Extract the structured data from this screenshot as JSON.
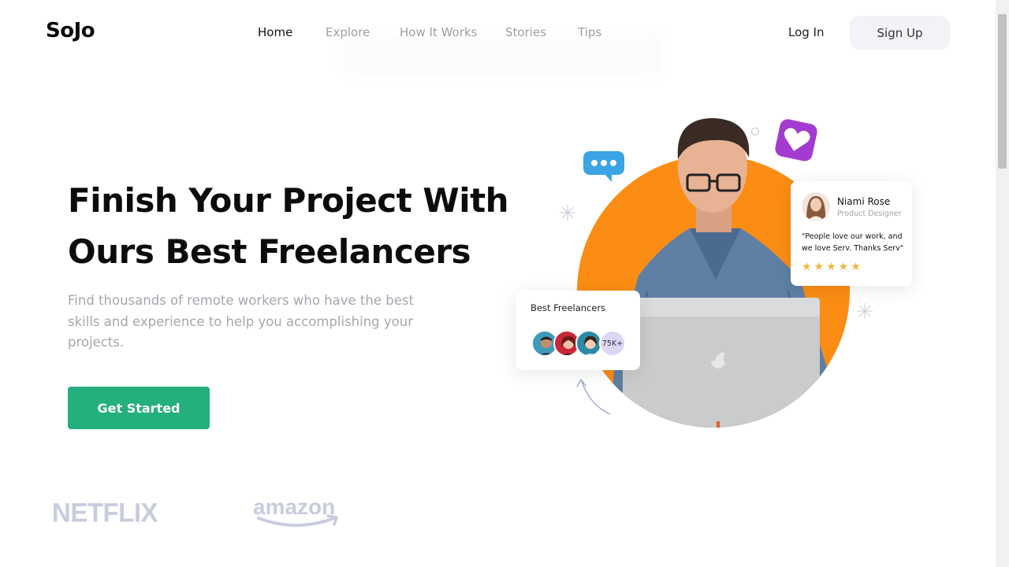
{
  "header": {
    "logo": "SoJo",
    "nav": [
      "Home",
      "Explore",
      "How It Works",
      "Stories",
      "Tips"
    ],
    "login_label": "Log In",
    "signup_label": "Sign Up"
  },
  "hero": {
    "title_line1": "Finish Your Project With",
    "title_line2": "Ours Best Freelancers",
    "subtitle": "Find thousands of remote workers who have the best skills and experience to help you accomplishing your projects.",
    "cta_label": "Get Started"
  },
  "freelancers_card": {
    "title": "Best Freelancers",
    "count": "75K+"
  },
  "review_card": {
    "name": "Niami Rose",
    "role": "Product Designer",
    "quote": "\"People love our work, and we love Serv. Thanks Serv\"",
    "stars": "★★★★★",
    "rating": 5
  },
  "brands": [
    "NETFLIX",
    "amazon"
  ],
  "colors": {
    "accent": "#23b07d",
    "orange": "#fb8d14",
    "chat": "#3aa4e4",
    "heart": "#a43bd0",
    "star": "#f4b63f",
    "brand_logo": "#c9ccde"
  }
}
